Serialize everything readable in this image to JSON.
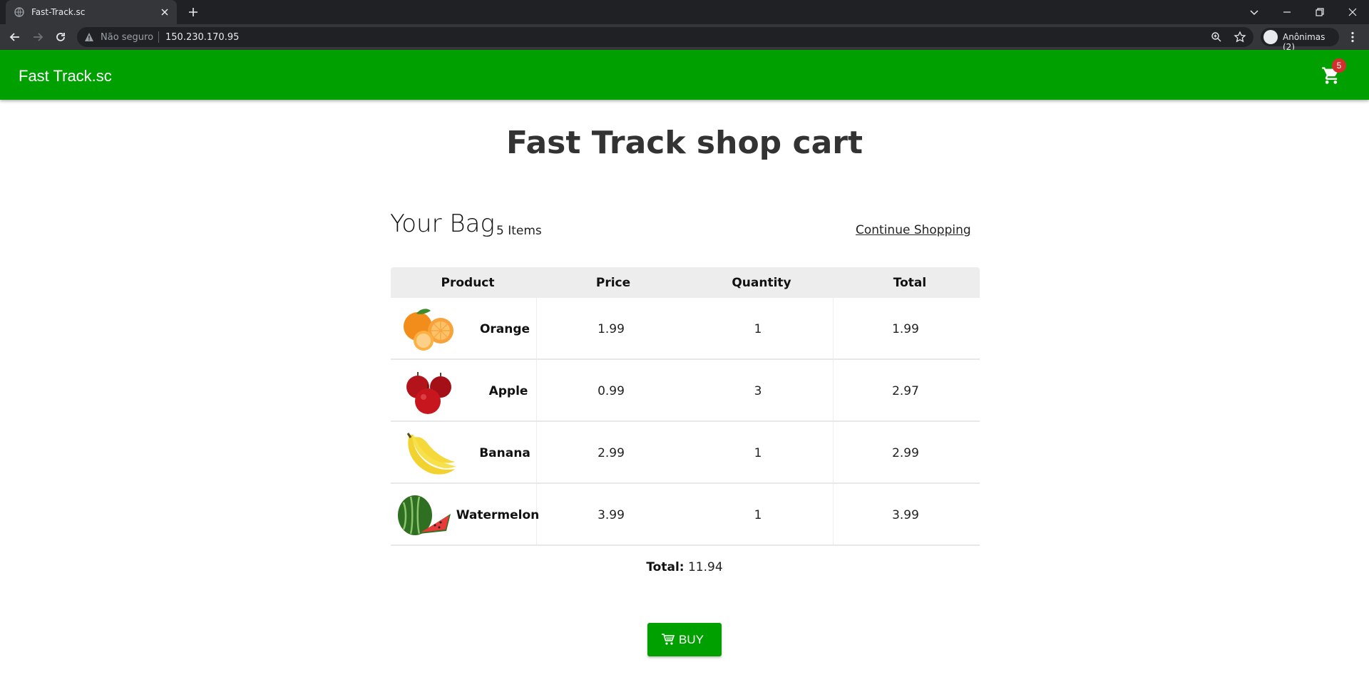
{
  "browser": {
    "tab_title": "Fast-Track.sc",
    "security_label": "Não seguro",
    "url": "150.230.170.95",
    "profile_label": "Anônimas (2)"
  },
  "header": {
    "brand": "Fast Track.sc",
    "cart_count": "5"
  },
  "main": {
    "title": "Fast Track shop cart",
    "bag_heading": "Your Bag",
    "bag_count": "5 Items",
    "continue_label": "Continue Shopping",
    "columns": [
      "Product",
      "Price",
      "Quantity",
      "Total"
    ],
    "items": [
      {
        "name": "Orange",
        "price": "1.99",
        "quantity": "1",
        "total": "1.99",
        "icon": "orange-image"
      },
      {
        "name": "Apple",
        "price": "0.99",
        "quantity": "3",
        "total": "2.97",
        "icon": "apple-image"
      },
      {
        "name": "Banana",
        "price": "2.99",
        "quantity": "1",
        "total": "2.99",
        "icon": "banana-image"
      },
      {
        "name": "Watermelon",
        "price": "3.99",
        "quantity": "1",
        "total": "3.99",
        "icon": "watermelon-image"
      }
    ],
    "total_label": "Total:",
    "total_value": "11.94",
    "buy_label": "BUY"
  },
  "colors": {
    "brand_green": "#00a000",
    "badge_red": "#d32f2f",
    "chrome_dark": "#202124"
  }
}
